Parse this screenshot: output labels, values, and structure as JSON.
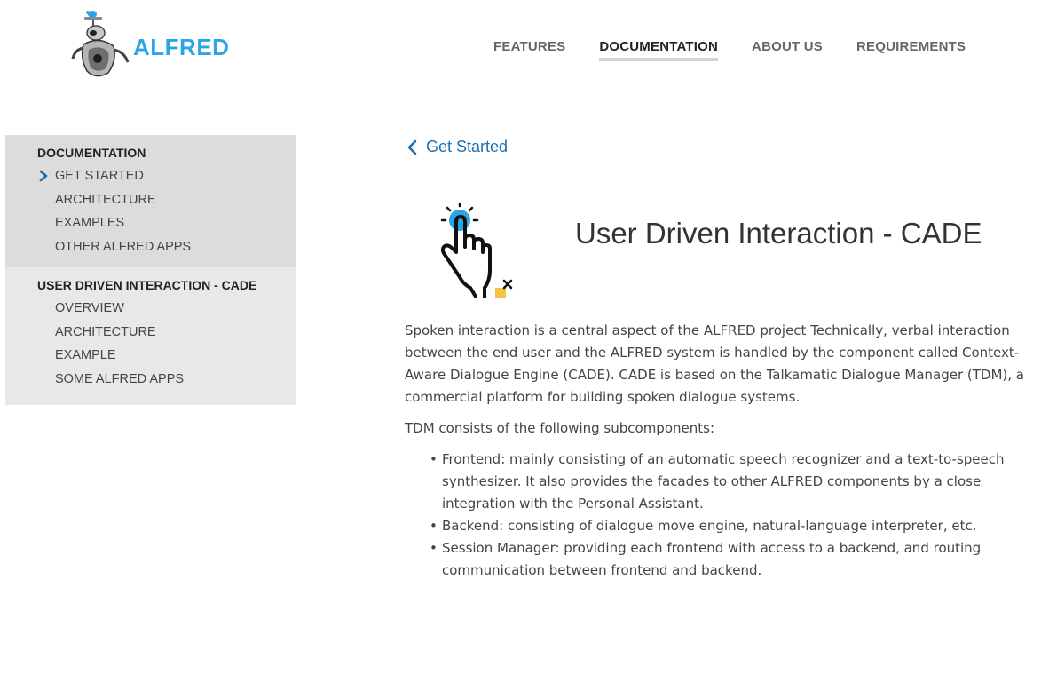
{
  "header": {
    "logo_text": "ALFRED",
    "nav": [
      "FEATURES",
      "DOCUMENTATION",
      "ABOUT US",
      "REQUIREMENTS"
    ],
    "active_nav": "DOCUMENTATION"
  },
  "sidebar": {
    "sections": [
      {
        "heading": "DOCUMENTATION",
        "items": [
          "GET STARTED",
          "ARCHITECTURE",
          "EXAMPLES",
          "OTHER ALFRED APPS"
        ],
        "current": "GET STARTED"
      },
      {
        "heading": "USER DRIVEN INTERACTION - CADE",
        "items": [
          "OVERVIEW",
          "ARCHITECTURE",
          "EXAMPLE",
          "SOME ALFRED APPS"
        ]
      }
    ]
  },
  "main": {
    "back_link": "Get Started",
    "title": "User Driven Interaction - CADE",
    "paragraph1": "Spoken interaction is a central aspect of the ALFRED project Technically, verbal interaction between the end user and the ALFRED system is handled by the component called Context-Aware Dialogue Engine (CADE). CADE is based on the Talkamatic Dialogue Manager (TDM), a commercial platform for building spoken dialogue systems.",
    "paragraph2": "TDM consists of the following subcomponents:",
    "bullets": [
      "Frontend: mainly consisting of an automatic speech recognizer and a text-to-speech synthesizer. It also provides the facades to other ALFRED components by a close integration with the Personal Assistant.",
      "Backend: consisting of dialogue move engine, natural-language interpreter, etc.",
      "Session Manager: providing each frontend with access to a backend, and routing communication between frontend and backend."
    ]
  },
  "colors": {
    "brand_blue": "#2aa6e8",
    "link_blue": "#1d6fb0",
    "sidebar_bg": "#dcdcdc",
    "sidebar_bg_alt": "#e8e8e8",
    "accent_yellow": "#f5c242"
  },
  "icons": [
    "alfred-robot-logo-icon",
    "chevron-right-icon",
    "chevron-left-icon",
    "touch-hand-icon"
  ]
}
